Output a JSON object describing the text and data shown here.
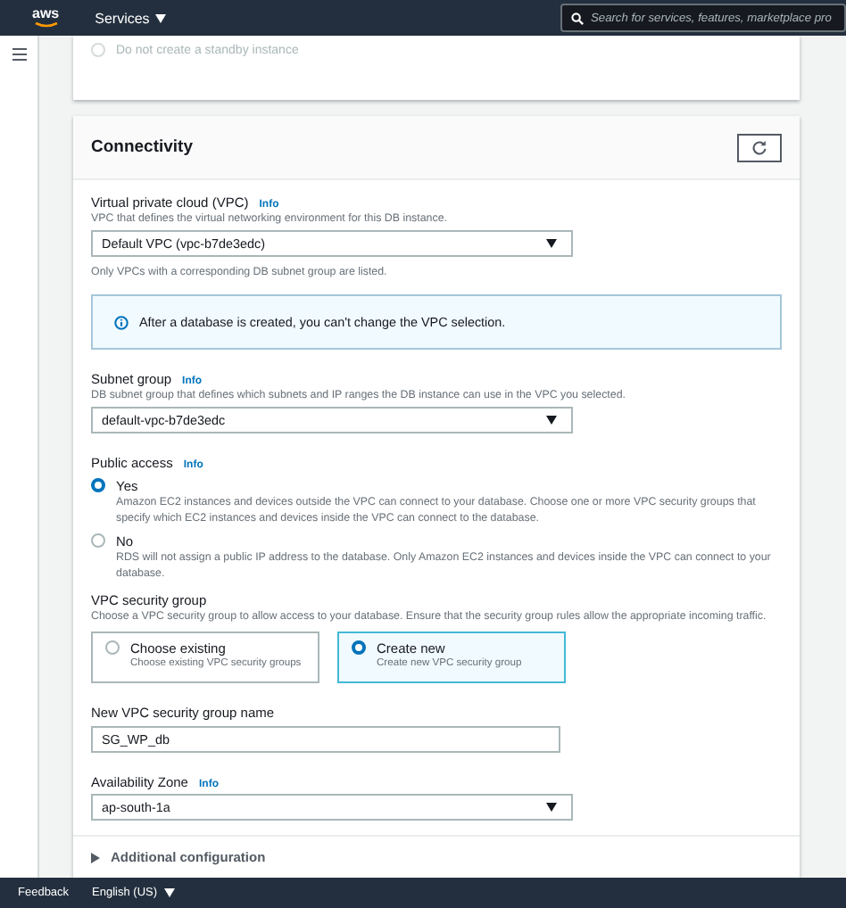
{
  "top_bar": {
    "logo": "aws",
    "services": "Services",
    "search_placeholder": "Search for services, features, marketplace pro"
  },
  "standby": {
    "label": "Do not create a standby instance",
    "selected": false,
    "disabled": true
  },
  "connectivity": {
    "title": "Connectivity",
    "vpc": {
      "label": "Virtual private cloud (VPC)",
      "info": "Info",
      "description": "VPC that defines the virtual networking environment for this DB instance.",
      "value": "Default VPC (vpc-b7de3edc)",
      "hint": "Only VPCs with a corresponding DB subnet group are listed."
    },
    "alert": "After a database is created, you can't change the VPC selection.",
    "subnet": {
      "label": "Subnet group",
      "info": "Info",
      "description": "DB subnet group that defines which subnets and IP ranges the DB instance can use in the VPC you selected.",
      "value": "default-vpc-b7de3edc"
    },
    "public_access": {
      "label": "Public access",
      "info": "Info",
      "options": [
        {
          "label": "Yes",
          "description": "Amazon EC2 instances and devices outside the VPC can connect to your database. Choose one or more VPC security groups that specify which EC2 instances and devices inside the VPC can connect to the database.",
          "selected": true
        },
        {
          "label": "No",
          "description": "RDS will not assign a public IP address to the database. Only Amazon EC2 instances and devices inside the VPC can connect to your database.",
          "selected": false
        }
      ]
    },
    "security_group": {
      "label": "VPC security group",
      "description": "Choose a VPC security group to allow access to your database. Ensure that the security group rules allow the appropriate incoming traffic.",
      "options": [
        {
          "label": "Choose existing",
          "description": "Choose existing VPC security groups",
          "selected": false
        },
        {
          "label": "Create new",
          "description": "Create new VPC security group",
          "selected": true
        }
      ]
    },
    "new_group_name": {
      "label": "New VPC security group name",
      "value": "SG_WP_db"
    },
    "availability_zone": {
      "label": "Availability Zone",
      "info": "Info",
      "value": "ap-south-1a"
    },
    "additional": {
      "label": "Additional configuration",
      "expanded": false
    }
  },
  "footer": {
    "feedback": "Feedback",
    "language": "English (US)"
  }
}
